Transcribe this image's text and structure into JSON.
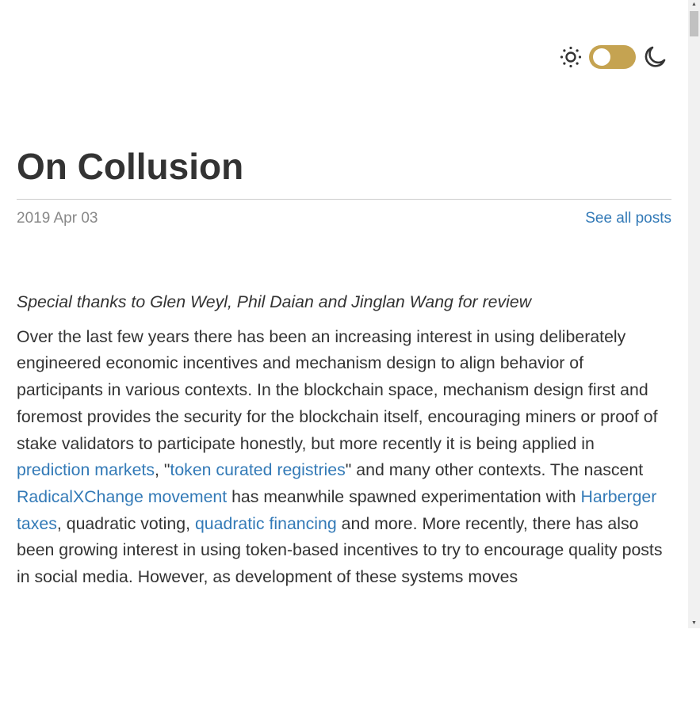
{
  "theme_toggle": {
    "sun_icon": "sun-icon",
    "moon_icon": "moon-icon",
    "state": "light",
    "accent": "#c5a351"
  },
  "post": {
    "title": "On Collusion",
    "date": "2019 Apr 03",
    "see_all": "See all posts",
    "thanks": "Special thanks to Glen Weyl, Phil Daian and Jinglan Wang for review",
    "p1": [
      "Over the last few years there has been an increasing interest in using deliberately engineered economic incentives and mechanism design to align behavior of participants in various contexts. In the blockchain space, mechanism design first and foremost provides the security for the blockchain itself, encouraging miners or proof of stake validators to participate honestly, but more recently it is being applied in ",
      "prediction markets",
      ", \"",
      "token curated registries",
      "\" and many other contexts. The nascent ",
      "RadicalXChange movement",
      " has meanwhile spawned experimentation with ",
      "Harberger taxes",
      ", quadratic voting, ",
      "quadratic financing",
      " and more. More recently, there has also been growing interest in using token-based incentives to try to encourage quality posts in social media. However, as development of these systems moves"
    ]
  }
}
